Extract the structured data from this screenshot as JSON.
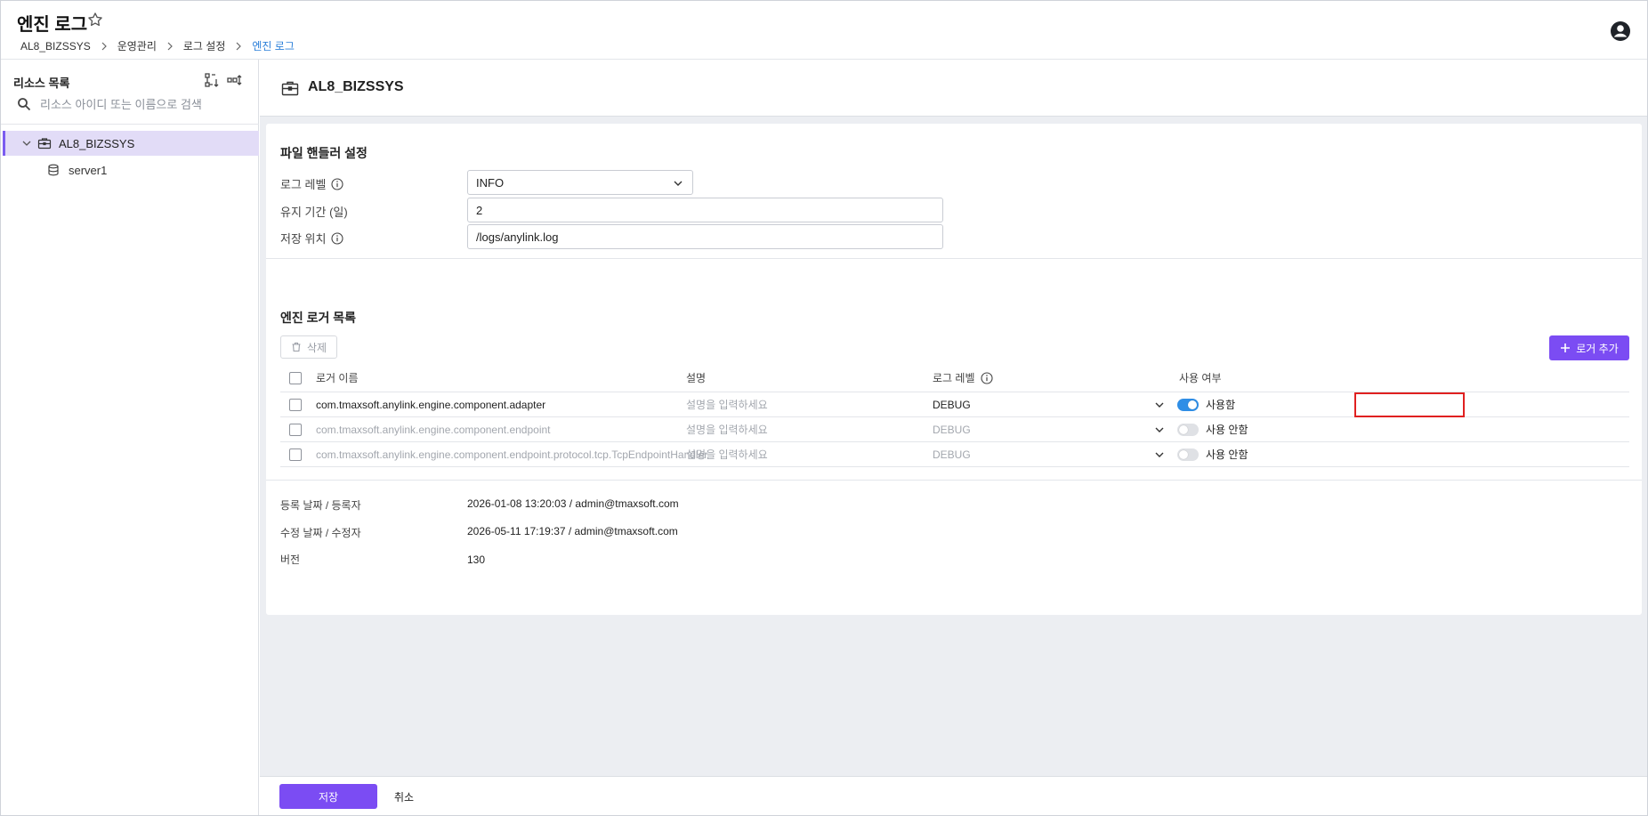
{
  "header": {
    "title": "엔진 로그",
    "breadcrumb": [
      "AL8_BIZSSYS",
      "운영관리",
      "로그 설정",
      "엔진 로그"
    ]
  },
  "sidebar": {
    "title": "리소스 목록",
    "search_placeholder": "리소스 아이디 또는 이름으로 검색",
    "tree": {
      "root_label": "AL8_BIZSSYS",
      "children": [
        "server1"
      ]
    }
  },
  "resource": {
    "title": "AL8_BIZSSYS"
  },
  "file_handler": {
    "section_title": "파일 핸들러 설정",
    "log_level_label": "로그 레벨",
    "log_level_value": "INFO",
    "retention_label": "유지 기간 (일)",
    "retention_value": "2",
    "location_label": "저장 위치",
    "location_value": "/logs/anylink.log"
  },
  "logger_list": {
    "section_title": "엔진 로거 목록",
    "delete_label": "삭제",
    "add_label": "로거 추가",
    "columns": {
      "name": "로거 이름",
      "description": "설명",
      "level": "로그 레벨",
      "enabled": "사용 여부"
    },
    "rows": [
      {
        "name": "com.tmaxsoft.anylink.engine.component.adapter",
        "description": "설명을 입력하세요",
        "level": "DEBUG",
        "enabled": true,
        "enabled_label": "사용함"
      },
      {
        "name": "com.tmaxsoft.anylink.engine.component.endpoint",
        "description": "설명을 입력하세요",
        "level": "DEBUG",
        "enabled": false,
        "enabled_label": "사용 안함"
      },
      {
        "name": "com.tmaxsoft.anylink.engine.component.endpoint.protocol.tcp.TcpEndpointHandler",
        "description": "설명을 입력하세요",
        "level": "DEBUG",
        "enabled": false,
        "enabled_label": "사용 안함"
      }
    ]
  },
  "meta": {
    "registered_label": "등록 날짜 / 등록자",
    "registered_value": "2026-01-08 13:20:03 / admin@tmaxsoft.com",
    "modified_label": "수정 날짜 / 수정자",
    "modified_value": "2026-05-11 17:19:37 / admin@tmaxsoft.com",
    "version_label": "버전",
    "version_value": "130"
  },
  "footer": {
    "save_label": "저장",
    "cancel_label": "취소"
  },
  "colors": {
    "accent": "#7b4cf3",
    "toggle_on": "#2f8ee6",
    "highlight": "#e02020",
    "breadcrumb_current": "#2b7fd9",
    "tree_selected_bg": "#e2dcf7"
  },
  "icons": [
    "star-icon",
    "chevron-right-icon",
    "user-icon",
    "tree-expand-icon",
    "tree-collapse-icon",
    "search-icon",
    "chevron-down-icon",
    "briefcase-icon",
    "database-icon",
    "info-icon",
    "trash-icon",
    "plus-icon"
  ]
}
